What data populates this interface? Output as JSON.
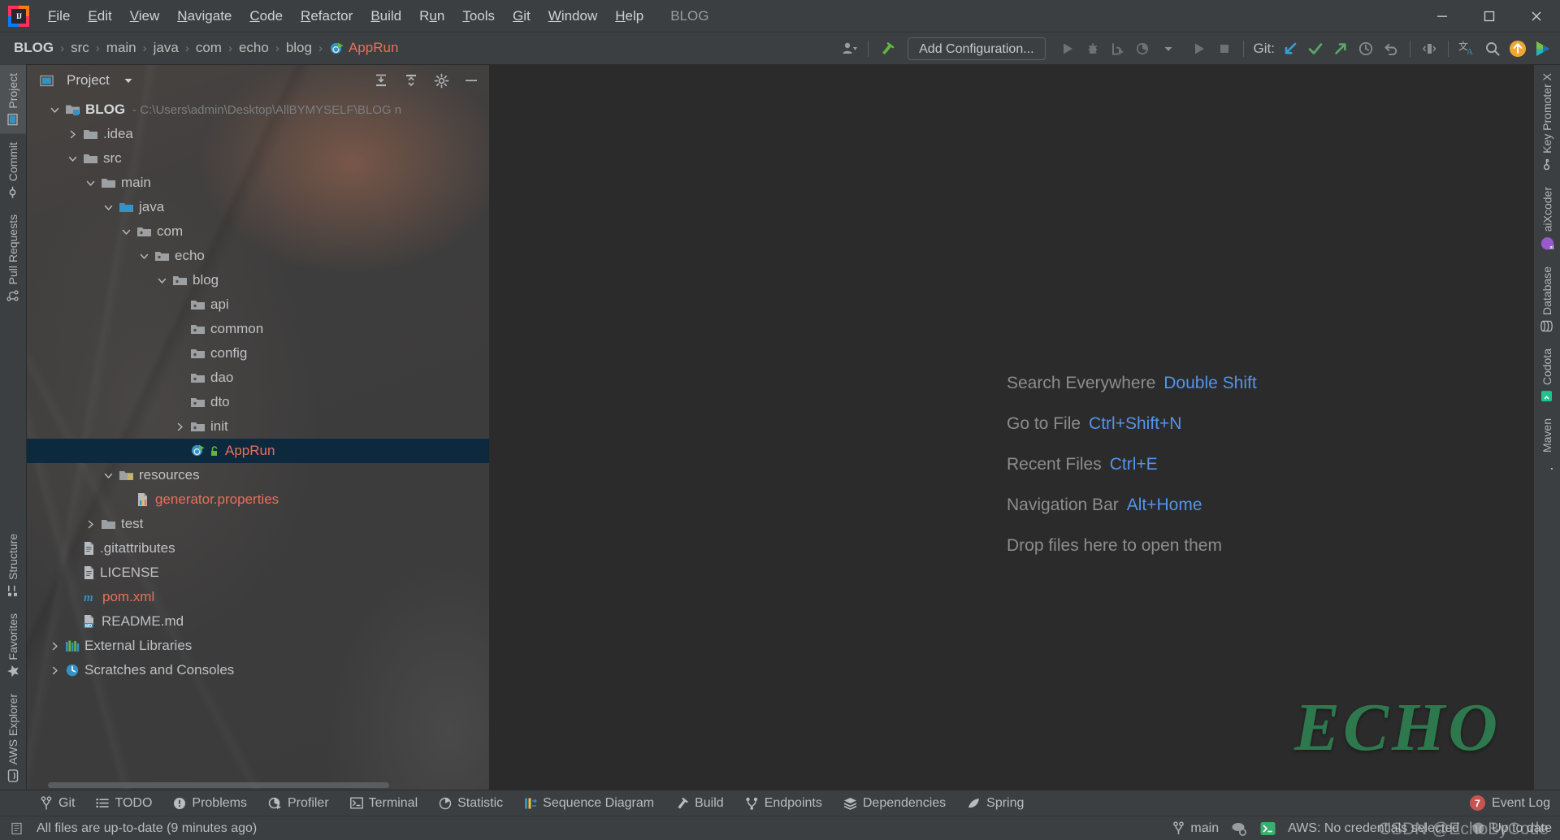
{
  "window": {
    "title": "BLOG",
    "app_icon": "intellij-idea-logo",
    "minimize_label": "Minimize",
    "maximize_label": "Maximize",
    "close_label": "Close"
  },
  "menubar": {
    "items": [
      {
        "label": "File",
        "mnemonic": "F"
      },
      {
        "label": "Edit",
        "mnemonic": "E"
      },
      {
        "label": "View",
        "mnemonic": "V"
      },
      {
        "label": "Navigate",
        "mnemonic": "N"
      },
      {
        "label": "Code",
        "mnemonic": "C"
      },
      {
        "label": "Refactor",
        "mnemonic": "R"
      },
      {
        "label": "Build",
        "mnemonic": "B"
      },
      {
        "label": "Run",
        "mnemonic": "u"
      },
      {
        "label": "Tools",
        "mnemonic": "T"
      },
      {
        "label": "Git",
        "mnemonic": "G"
      },
      {
        "label": "Window",
        "mnemonic": "W"
      },
      {
        "label": "Help",
        "mnemonic": "H"
      }
    ]
  },
  "navbar": {
    "crumbs": [
      "BLOG",
      "src",
      "main",
      "java",
      "com",
      "echo",
      "blog"
    ],
    "separator": "›",
    "current_file": "AppRun",
    "current_file_icon": "java-class-run-icon"
  },
  "toolbar": {
    "profile_label": "user-profile",
    "hammer_label": "build-project",
    "run_config_label": "Add Configuration...",
    "run_label": "Run",
    "debug_label": "Debug",
    "run_coverage_label": "Run with Coverage",
    "profile_run_label": "Profile",
    "more_label": "More",
    "run_anything_label": "Run Anything",
    "stop_label": "Stop",
    "git_label": "Git:",
    "git_update_label": "Update Project",
    "git_commit_label": "Commit",
    "git_push_label": "Push",
    "git_history_label": "History",
    "git_rollback_label": "Rollback",
    "diff_label": "Compare",
    "translate_label": "Translate",
    "search_label": "Search Everywhere",
    "updates_label": "IDE Updates",
    "plugin_label": "Plugin"
  },
  "left_strip": {
    "top": [
      {
        "label": "Project",
        "icon": "project-icon",
        "active": true
      },
      {
        "label": "Commit",
        "icon": "commit-icon",
        "active": false
      },
      {
        "label": "Pull Requests",
        "icon": "pull-request-icon",
        "active": false
      }
    ],
    "bottom": [
      {
        "label": "Structure",
        "icon": "structure-icon"
      },
      {
        "label": "Favorites",
        "icon": "star-icon"
      },
      {
        "label": "AWS Explorer",
        "icon": "aws-icon"
      }
    ]
  },
  "right_strip": {
    "items": [
      {
        "label": "Key Promoter X",
        "icon": "key-icon"
      },
      {
        "label": "aiXcoder",
        "icon": "aixcoder-icon"
      },
      {
        "label": "Database",
        "icon": "database-icon"
      },
      {
        "label": "Codota",
        "icon": "codota-icon"
      },
      {
        "label": "Maven",
        "icon": "maven-icon"
      }
    ]
  },
  "project_panel": {
    "title": "Project",
    "dropdown_icon": "chevron-down-icon",
    "collapse_all_label": "Collapse All",
    "expand_all_label": "Expand All",
    "settings_label": "Settings",
    "hide_label": "Hide",
    "tree": [
      {
        "label": "BLOG",
        "path": "- C:\\Users\\admin\\Desktop\\AllBYMYSELF\\BLOG n",
        "indent": 0,
        "arrow": "down",
        "icon": "module-folder-icon",
        "bold": true
      },
      {
        "label": ".idea",
        "indent": 1,
        "arrow": "right",
        "icon": "folder-icon"
      },
      {
        "label": "src",
        "indent": 1,
        "arrow": "down",
        "icon": "folder-icon"
      },
      {
        "label": "main",
        "indent": 2,
        "arrow": "down",
        "icon": "folder-icon"
      },
      {
        "label": "java",
        "indent": 3,
        "arrow": "down",
        "icon": "source-folder-icon"
      },
      {
        "label": "com",
        "indent": 4,
        "arrow": "down",
        "icon": "package-icon"
      },
      {
        "label": "echo",
        "indent": 5,
        "arrow": "down",
        "icon": "package-icon"
      },
      {
        "label": "blog",
        "indent": 6,
        "arrow": "down",
        "icon": "package-icon"
      },
      {
        "label": "api",
        "indent": 7,
        "arrow": "none",
        "icon": "package-icon"
      },
      {
        "label": "common",
        "indent": 7,
        "arrow": "none",
        "icon": "package-icon"
      },
      {
        "label": "config",
        "indent": 7,
        "arrow": "none",
        "icon": "package-icon"
      },
      {
        "label": "dao",
        "indent": 7,
        "arrow": "none",
        "icon": "package-icon"
      },
      {
        "label": "dto",
        "indent": 7,
        "arrow": "none",
        "icon": "package-icon"
      },
      {
        "label": "init",
        "indent": 7,
        "arrow": "right",
        "icon": "package-icon"
      },
      {
        "label": "AppRun",
        "indent": 7,
        "arrow": "none",
        "icon": "java-class-run-icon",
        "selected": true,
        "red": true
      },
      {
        "label": "resources",
        "indent": 3,
        "arrow": "down",
        "icon": "resources-folder-icon"
      },
      {
        "label": "generator.properties",
        "indent": 4,
        "arrow": "none",
        "icon": "properties-file-icon",
        "red": true
      },
      {
        "label": "test",
        "indent": 2,
        "arrow": "right",
        "icon": "folder-icon"
      },
      {
        "label": ".gitattributes",
        "indent": 1,
        "arrow": "none",
        "icon": "text-file-icon"
      },
      {
        "label": "LICENSE",
        "indent": 1,
        "arrow": "none",
        "icon": "text-file-icon"
      },
      {
        "label": "pom.xml",
        "indent": 1,
        "arrow": "none",
        "icon": "maven-file-icon",
        "red": true
      },
      {
        "label": "README.md",
        "indent": 1,
        "arrow": "none",
        "icon": "markdown-file-icon"
      },
      {
        "label": "External Libraries",
        "indent": 0,
        "arrow": "right",
        "icon": "libraries-icon"
      },
      {
        "label": "Scratches and Consoles",
        "indent": 0,
        "arrow": "right",
        "icon": "scratches-icon"
      }
    ]
  },
  "editor": {
    "hints": [
      {
        "action": "Search Everywhere",
        "shortcut": "Double Shift"
      },
      {
        "action": "Go to File",
        "shortcut": "Ctrl+Shift+N"
      },
      {
        "action": "Recent Files",
        "shortcut": "Ctrl+E"
      },
      {
        "action": "Navigation Bar",
        "shortcut": "Alt+Home"
      },
      {
        "action": "Drop files here to open them",
        "shortcut": ""
      }
    ],
    "watermark": "ECHO"
  },
  "bottom_bar": {
    "items": [
      {
        "label": "Git",
        "icon": "git-branch-icon"
      },
      {
        "label": "TODO",
        "icon": "todo-icon"
      },
      {
        "label": "Problems",
        "icon": "problems-icon"
      },
      {
        "label": "Profiler",
        "icon": "profiler-icon"
      },
      {
        "label": "Terminal",
        "icon": "terminal-icon"
      },
      {
        "label": "Statistic",
        "icon": "statistic-icon"
      },
      {
        "label": "Sequence Diagram",
        "icon": "sequence-diagram-icon"
      },
      {
        "label": "Build",
        "icon": "build-hammer-icon"
      },
      {
        "label": "Endpoints",
        "icon": "endpoints-icon"
      },
      {
        "label": "Dependencies",
        "icon": "dependencies-icon"
      },
      {
        "label": "Spring",
        "icon": "spring-leaf-icon"
      }
    ],
    "event_log": {
      "label": "Event Log",
      "badge": "7",
      "icon": "event-log-badge"
    }
  },
  "status_bar": {
    "message": "All files are up-to-date (9 minutes ago)",
    "message_icon": "vcs-status-icon",
    "branch": "main",
    "branch_icon": "git-branch-icon",
    "aws_text": "AWS: No credentials selected",
    "aws_icon": "aws-cloud-icon",
    "terminal_icon": "terminal-green-icon",
    "updates_text": "Up to date",
    "updates_icon": "sync-icon"
  },
  "watermark": {
    "text": "CSDN @EchoByCode"
  },
  "colors": {
    "accent_blue": "#5394ec",
    "selection": "#0d293e",
    "red_file": "#e8705a",
    "green": "#499c54",
    "panel_bg": "#3c3f41",
    "editor_bg": "#2b2b2b"
  }
}
